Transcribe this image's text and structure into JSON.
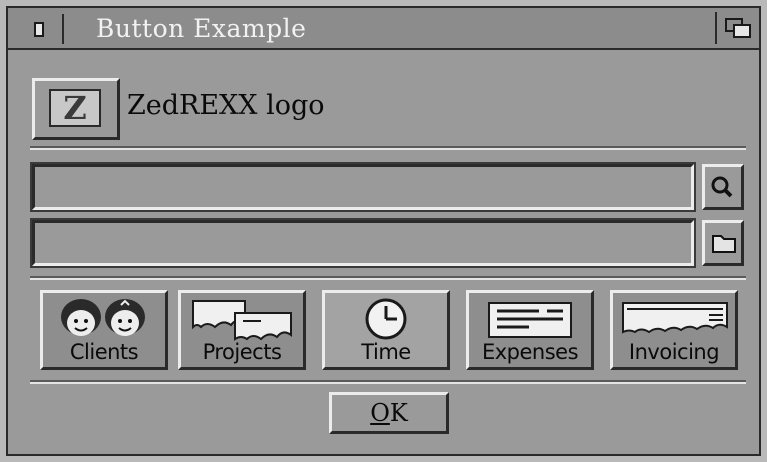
{
  "window": {
    "title": "Button Example"
  },
  "logo": {
    "glyph": "Z",
    "label": "ZedREXX logo"
  },
  "fields": [
    {
      "value": "",
      "action_icon": "search-icon"
    },
    {
      "value": "",
      "action_icon": "folder-icon"
    }
  ],
  "toolbar": {
    "buttons": [
      {
        "label": "Clients",
        "icon": "people-faces-icon"
      },
      {
        "label": "Projects",
        "icon": "projects-icon"
      },
      {
        "label": "Time",
        "icon": "clock-icon",
        "selected": true
      },
      {
        "label": "Expenses",
        "icon": "expenses-icon"
      },
      {
        "label": "Invoicing",
        "icon": "invoice-icon"
      }
    ]
  },
  "ok_button": {
    "hotkey": "O",
    "rest": "K"
  }
}
